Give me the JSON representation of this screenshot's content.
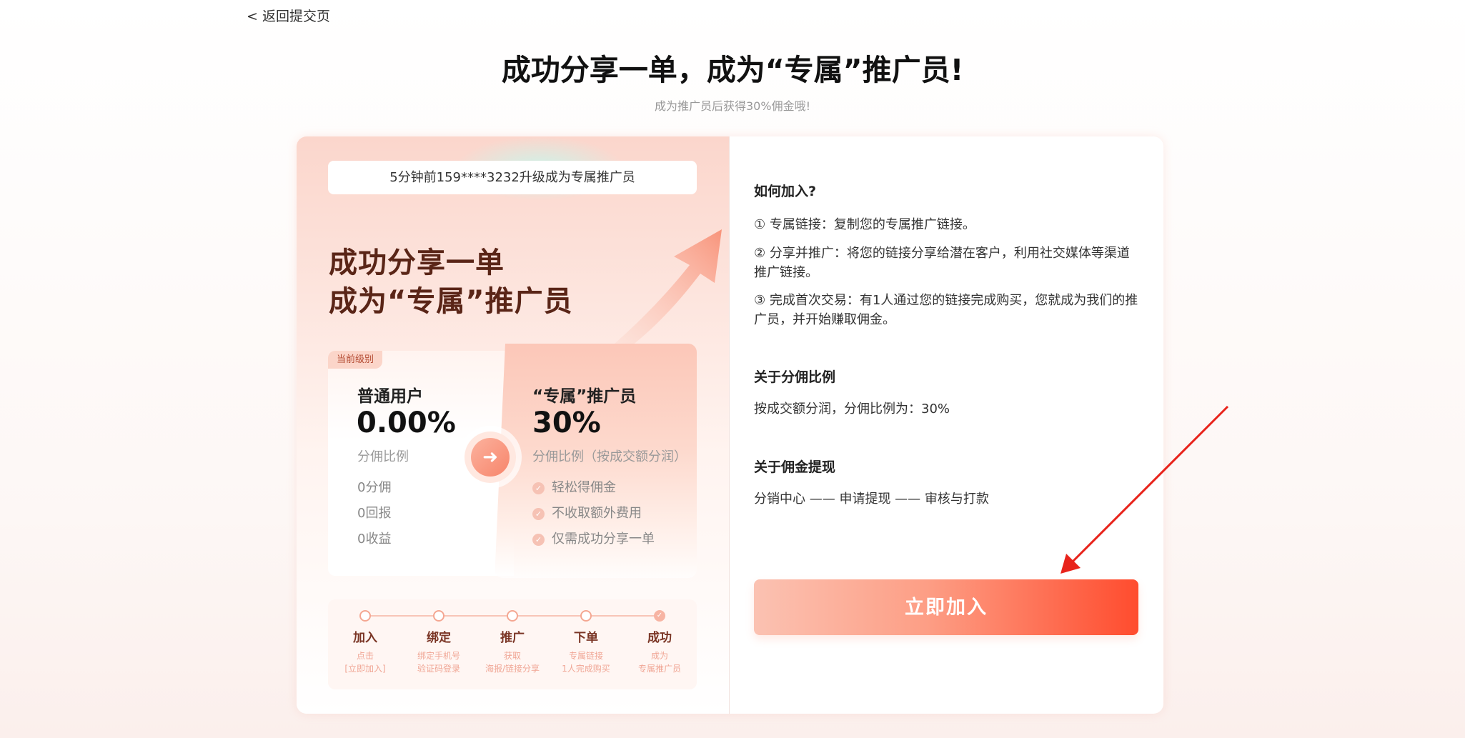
{
  "nav": {
    "back_label": "< 返回提交页"
  },
  "header": {
    "title": "成功分享一单，成为“专属”推广员!",
    "subtitle": "成为推广员后获得30%佣金哦!"
  },
  "ticker": {
    "text": "5分钟前159****3232升级成为专属推广员"
  },
  "hero": {
    "line1": "成功分享一单",
    "line2": "成为“专属”推广员"
  },
  "current_tier": {
    "badge": "当前级别",
    "title": "普通用户",
    "value": "0.00%",
    "label": "分佣比例",
    "features": [
      "0分佣",
      "0回报",
      "0收益"
    ]
  },
  "promoter_tier": {
    "title": "“专属”推广员",
    "value": "30%",
    "label": "分佣比例（按成交额分润）",
    "features": [
      "轻松得佣金",
      "不收取额外费用",
      "仅需成功分享一单"
    ]
  },
  "steps": [
    {
      "name": "加入",
      "desc1": "点击",
      "desc2": "[立即加入]",
      "done": false
    },
    {
      "name": "绑定",
      "desc1": "绑定手机号",
      "desc2": "验证码登录",
      "done": false
    },
    {
      "name": "推广",
      "desc1": "获取",
      "desc2": "海报/链接分享",
      "done": false
    },
    {
      "name": "下单",
      "desc1": "专属链接",
      "desc2": "1人完成购买",
      "done": false
    },
    {
      "name": "成功",
      "desc1": "成为",
      "desc2": "专属推广员",
      "done": true
    }
  ],
  "how_to_join": {
    "title": "如何加入?",
    "items": [
      "① 专属链接：复制您的专属推广链接。",
      "② 分享并推广：将您的链接分享给潜在客户，利用社交媒体等渠道推广链接。",
      "③ 完成首次交易：有1人通过您的链接完成购买，您就成为我们的推广员，并开始赚取佣金。"
    ]
  },
  "commission_ratio": {
    "title": "关于分佣比例",
    "text": "按成交额分润，分佣比例为：30%"
  },
  "withdrawal": {
    "title": "关于佣金提现",
    "text": "分销中心 —— 申请提现 —— 审核与打款"
  },
  "cta": {
    "join_label": "立即加入"
  },
  "colors": {
    "accent": "#ff4c2e",
    "accent_light": "#fbc2b2",
    "hero_text": "#5a2517",
    "annotation_arrow": "#e8231b"
  },
  "icons": {
    "switch": "arrow-right-icon",
    "check": "check-circle-icon",
    "annotation": "red-pointer-arrow-icon"
  }
}
